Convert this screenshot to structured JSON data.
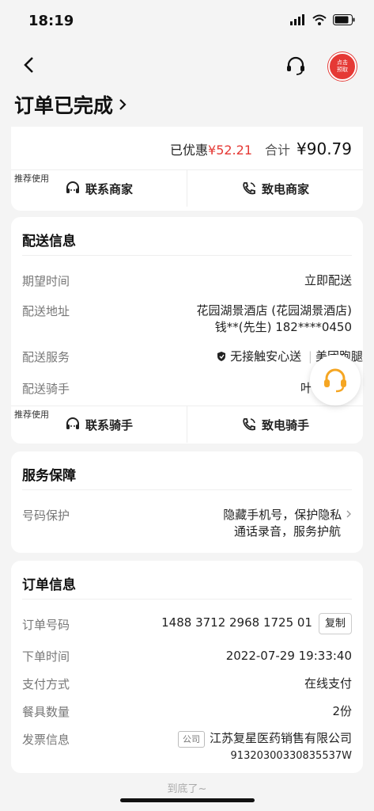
{
  "status_bar": {
    "time": "18:19"
  },
  "nav": {
    "badge_line1": "点击",
    "badge_line2": "预取"
  },
  "page_title": "订单已完成",
  "payment": {
    "discount_label": "已优惠",
    "discount_value": "¥52.21",
    "total_label": "合计",
    "total_value": "¥90.79"
  },
  "merchant_actions": {
    "tag": "推荐使用",
    "contact": "联系商家",
    "call": "致电商家"
  },
  "delivery": {
    "title": "配送信息",
    "expected_time_label": "期望时间",
    "expected_time_value": "立即配送",
    "address_label": "配送地址",
    "address_line1": "花园湖景酒店 (花园湖景酒店)",
    "address_line2": "钱**(先生) 182****0450",
    "service_label": "配送服务",
    "service_value": "无接触安心送",
    "service_extra": "美团跑腿",
    "rider_label": "配送骑手",
    "rider_value": "叶"
  },
  "rider_actions": {
    "tag": "推荐使用",
    "contact": "联系骑手",
    "call": "致电骑手"
  },
  "guarantee": {
    "title": "服务保障",
    "label": "号码保护",
    "line1": "隐藏手机号，保护隐私",
    "line2": "通话录音，服务护航"
  },
  "order": {
    "title": "订单信息",
    "no_label": "订单号码",
    "no_value": "1488 3712 2968 1725 01",
    "copy": "复制",
    "time_label": "下单时间",
    "time_value": "2022-07-29 19:33:40",
    "pay_label": "支付方式",
    "pay_value": "在线支付",
    "utensil_label": "餐具数量",
    "utensil_value": "2份",
    "invoice_label": "发票信息",
    "invoice_tag": "公司",
    "invoice_company": "江苏复星医药销售有限公司",
    "invoice_tax": "91320300330835537W"
  },
  "footer": "到底了~",
  "colors": {
    "accent": "#e53935",
    "gold": "#f5a623"
  }
}
